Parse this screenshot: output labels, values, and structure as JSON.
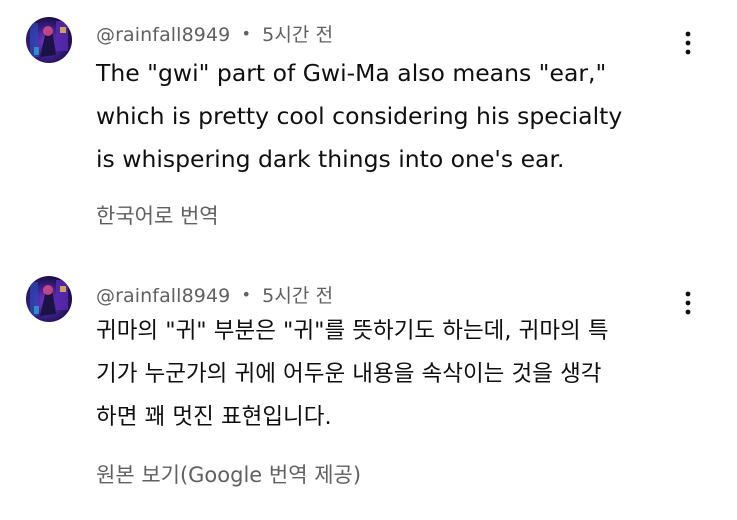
{
  "comments": [
    {
      "author": "@rainfall8949",
      "separator": "•",
      "time": "5시간 전",
      "lines": [
        "The \"gwi\" part of Gwi-Ma also means \"ear,\"",
        "which is pretty cool considering his specialty",
        "is whispering dark things into one's ear."
      ],
      "translate_link": "한국어로 번역",
      "more_icon": "more-vert-icon"
    },
    {
      "author": "@rainfall8949",
      "separator": "•",
      "time": "5시간 전",
      "lines": [
        "귀마의 \"귀\" 부분은 \"귀\"를 뜻하기도 하는데, 귀마의 특",
        "기가 누군가의 귀에 어두운 내용을 속삭이는 것을 생각",
        "하면 꽤 멋진 표현입니다."
      ],
      "translate_link": "원본 보기(Google 번역 제공)",
      "more_icon": "more-vert-icon"
    }
  ],
  "colors": {
    "text_primary": "#0f0f0f",
    "text_secondary": "#606060",
    "background": "#ffffff"
  }
}
